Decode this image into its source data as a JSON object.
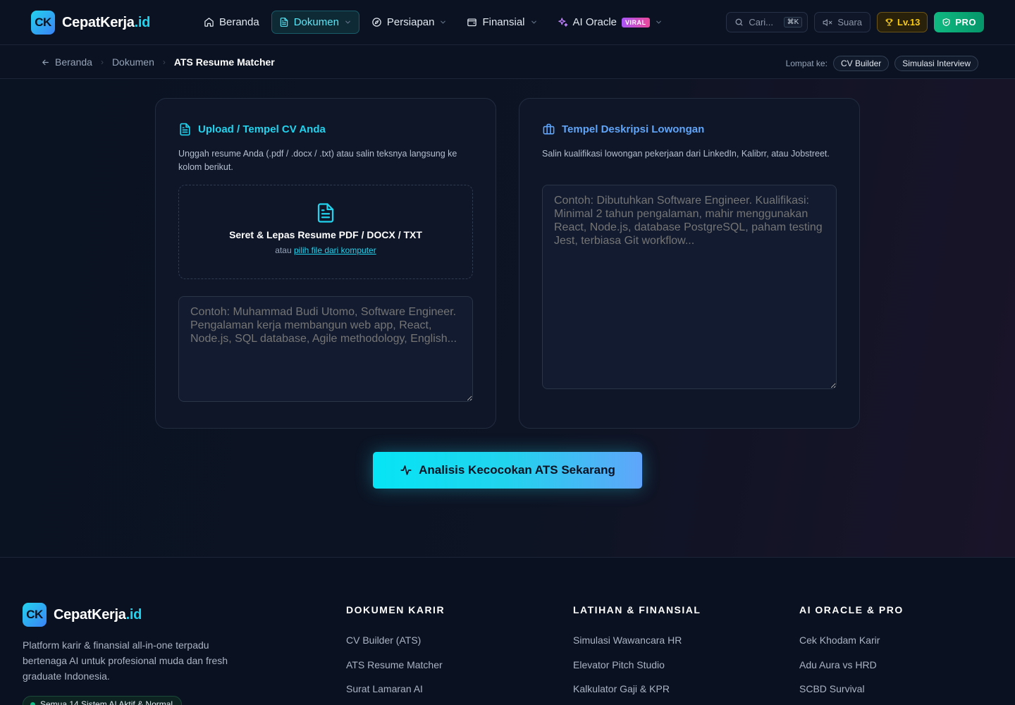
{
  "brand": {
    "badge": "CK",
    "name": "CepatKerja",
    "tld": ".id",
    "accent_color": "#22d3ee"
  },
  "nav": {
    "items": [
      {
        "label": "Beranda",
        "icon": "home-icon",
        "dropdown": false,
        "active": false
      },
      {
        "label": "Dokumen",
        "icon": "file-icon",
        "dropdown": true,
        "active": true
      },
      {
        "label": "Persiapan",
        "icon": "compass-icon",
        "dropdown": true,
        "active": false
      },
      {
        "label": "Finansial",
        "icon": "wallet-icon",
        "dropdown": true,
        "active": false
      },
      {
        "label": "AI Oracle",
        "icon": "sparkles-icon",
        "dropdown": true,
        "active": false,
        "badge": "VIRAL"
      }
    ],
    "search_placeholder": "Cari...",
    "search_shortcut": "⌘K",
    "sound_label": "Suara",
    "level_label": "Lv.13",
    "pro_label": "PRO"
  },
  "breadcrumb": {
    "home": "Beranda",
    "section": "Dokumen",
    "current": "ATS Resume Matcher",
    "jump_label": "Lompat ke:",
    "jump_links": [
      "CV Builder",
      "Simulasi Interview"
    ]
  },
  "cv_card": {
    "title": "Upload / Tempel CV Anda",
    "description": "Unggah resume Anda (.pdf / .docx / .txt) atau salin teksnya langsung ke kolom berikut.",
    "dropzone_title": "Seret & Lepas Resume PDF / DOCX / TXT",
    "dropzone_or": "atau",
    "dropzone_link": "pilih file dari komputer",
    "textarea_placeholder": "Contoh: Muhammad Budi Utomo, Software Engineer. Pengalaman kerja membangun web app, React, Node.js, SQL database, Agile methodology, English..."
  },
  "jd_card": {
    "title": "Tempel Deskripsi Lowongan",
    "description": "Salin kualifikasi lowongan pekerjaan dari LinkedIn, Kalibrr, atau Jobstreet.",
    "textarea_placeholder": "Contoh: Dibutuhkan Software Engineer. Kualifikasi: Minimal 2 tahun pengalaman, mahir menggunakan React, Node.js, database PostgreSQL, paham testing Jest, terbiasa Git workflow..."
  },
  "analyze_button": "Analisis Kecocokan ATS Sekarang",
  "footer": {
    "description": "Platform karir & finansial all-in-one terpadu bertenaga AI untuk profesional muda dan fresh graduate Indonesia.",
    "status": "Semua 14 Sistem AI Aktif & Normal",
    "columns": [
      {
        "title": "DOKUMEN KARIR",
        "links": [
          "CV Builder (ATS)",
          "ATS Resume Matcher",
          "Surat Lamaran AI"
        ]
      },
      {
        "title": "LATIHAN & FINANSIAL",
        "links": [
          "Simulasi Wawancara HR",
          "Elevator Pitch Studio",
          "Kalkulator Gaji & KPR"
        ]
      },
      {
        "title": "AI ORACLE & PRO",
        "links": [
          "Cek Khodam Karir",
          "Adu Aura vs HRD",
          "SCBD Survival"
        ]
      }
    ]
  }
}
